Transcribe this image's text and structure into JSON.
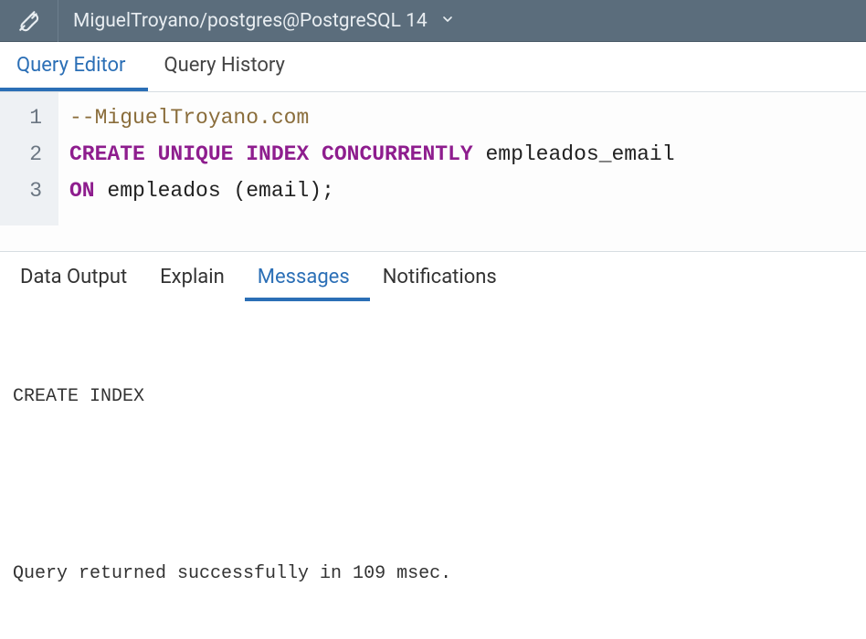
{
  "header": {
    "connection": "MiguelTroyano/postgres@PostgreSQL 14"
  },
  "upper_tabs": {
    "editor": "Query Editor",
    "history": "Query History",
    "active": "editor"
  },
  "editor": {
    "line_numbers": [
      "1",
      "2",
      "3"
    ],
    "lines": [
      {
        "tokens": [
          {
            "cls": "tok-comment",
            "text": "--MiguelTroyano.com"
          }
        ]
      },
      {
        "tokens": [
          {
            "cls": "tok-keyword",
            "text": "CREATE UNIQUE INDEX CONCURRENTLY"
          },
          {
            "cls": "tok-plain",
            "text": " empleados_email"
          }
        ]
      },
      {
        "tokens": [
          {
            "cls": "tok-keyword",
            "text": "ON"
          },
          {
            "cls": "tok-plain",
            "text": " empleados "
          },
          {
            "cls": "tok-paren",
            "text": "("
          },
          {
            "cls": "tok-plain",
            "text": "email"
          },
          {
            "cls": "tok-paren",
            "text": ")"
          },
          {
            "cls": "tok-plain",
            "text": ";"
          }
        ]
      }
    ]
  },
  "lower_tabs": {
    "data_output": "Data Output",
    "explain": "Explain",
    "messages": "Messages",
    "notifications": "Notifications",
    "active": "messages"
  },
  "messages": {
    "line1": "CREATE INDEX",
    "line2": "Query returned successfully in 109 msec."
  }
}
